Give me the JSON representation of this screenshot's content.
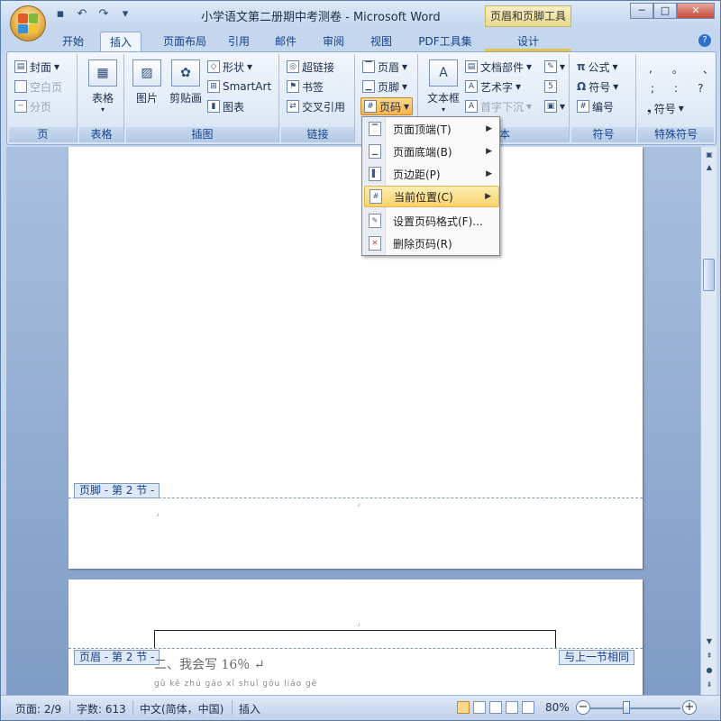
{
  "window": {
    "title": "小学语文第二册期中考测卷 - Microsoft Word",
    "context_tool_title": "页眉和页脚工具",
    "controls": {
      "minimize": "─",
      "maximize": "□",
      "close": "✕"
    }
  },
  "quick_access": {
    "save": "▪",
    "undo": "↶",
    "redo": "↷",
    "customize": "▾"
  },
  "tabs": [
    "开始",
    "插入",
    "页面布局",
    "引用",
    "邮件",
    "审阅",
    "视图",
    "PDF工具集",
    "设计"
  ],
  "active_tab": "插入",
  "ribbon": {
    "groups": {
      "page": {
        "label": "页",
        "items": [
          "封面",
          "空白页",
          "分页"
        ]
      },
      "table": {
        "label": "表格",
        "button": "表格"
      },
      "illustrations": {
        "label": "插图",
        "picture": "图片",
        "clipart": "剪贴画",
        "shapes": "形状",
        "smartart": "SmartArt",
        "chart": "图表"
      },
      "links": {
        "label": "链接",
        "hyperlink": "超链接",
        "bookmark": "书签",
        "crossref": "交叉引用"
      },
      "header_footer": {
        "header": "页眉",
        "footer": "页脚",
        "page_number": "页码"
      },
      "text": {
        "label": "文本",
        "label_partial": "本",
        "textbox": "文本框",
        "quickparts": "文档部件",
        "wordart": "艺术字",
        "dropcap": "首字下沉"
      },
      "symbols": {
        "label": "符号",
        "equation": "公式",
        "symbol": "符号",
        "numbering": "编号"
      },
      "special": {
        "label": "特殊符号",
        "symbols_row1": [
          ",",
          "。",
          "、"
        ],
        "symbols_row2": [
          ";",
          ":",
          "?"
        ],
        "symbol_btn": "符号"
      }
    }
  },
  "page_number_menu": {
    "items": [
      {
        "label": "页面顶端(T)",
        "submenu": true
      },
      {
        "label": "页面底端(B)",
        "submenu": true
      },
      {
        "label": "页边距(P)",
        "submenu": true
      },
      {
        "label": "当前位置(C)",
        "submenu": true,
        "highlighted": true
      },
      {
        "label": "设置页码格式(F)...",
        "submenu": false
      },
      {
        "label": "删除页码(R)",
        "submenu": false
      }
    ]
  },
  "document": {
    "footer_tab": "页脚 - 第 2 节 -",
    "header_tab": "页眉 - 第 2 节 -",
    "same_as_previous": "与上一节相同",
    "body_line": "二、我会写 16％ ↵",
    "pinyin_line": "ɡǔ kě zhú ɡāo xǐ shuǐ ɡǒu liǎo ɡē"
  },
  "status_bar": {
    "page": "页面: 2/9",
    "words": "字数: 613",
    "language": "中文(简体，中国)",
    "mode": "插入",
    "zoom": "80%"
  }
}
